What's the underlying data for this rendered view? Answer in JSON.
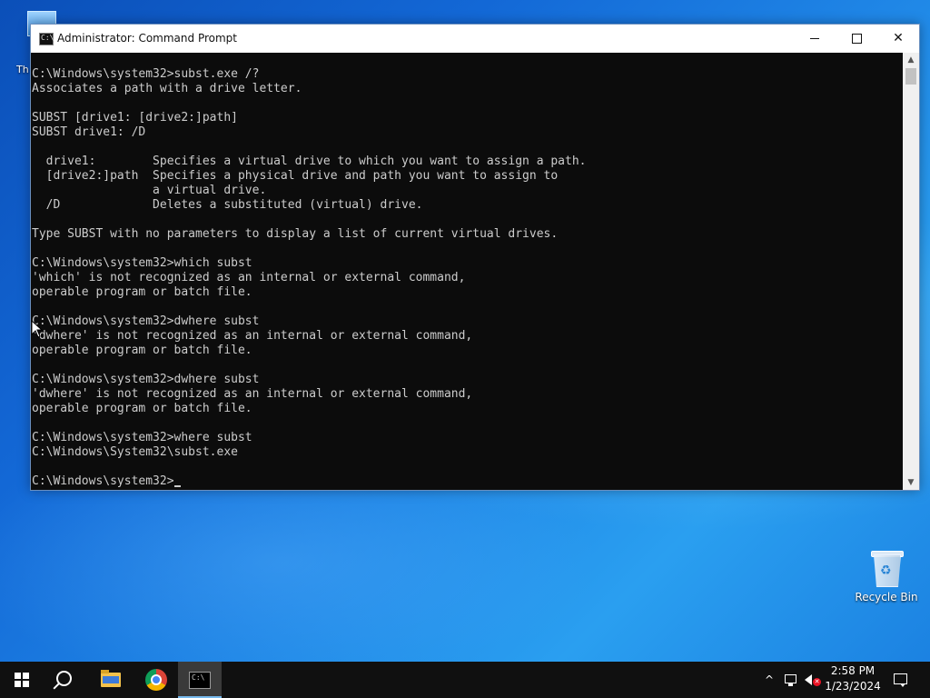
{
  "desktop": {
    "icons": [
      {
        "label": "Th"
      },
      {
        "label": "Recycle Bin"
      }
    ]
  },
  "window": {
    "title": "Administrator: Command Prompt",
    "icon_text": "C:\\",
    "console_lines": [
      "",
      "C:\\Windows\\system32>subst.exe /?",
      "Associates a path with a drive letter.",
      "",
      "SUBST [drive1: [drive2:]path]",
      "SUBST drive1: /D",
      "",
      "  drive1:        Specifies a virtual drive to which you want to assign a path.",
      "  [drive2:]path  Specifies a physical drive and path you want to assign to",
      "                 a virtual drive.",
      "  /D             Deletes a substituted (virtual) drive.",
      "",
      "Type SUBST with no parameters to display a list of current virtual drives.",
      "",
      "C:\\Windows\\system32>which subst",
      "'which' is not recognized as an internal or external command,",
      "operable program or batch file.",
      "",
      "C:\\Windows\\system32>dwhere subst",
      "'dwhere' is not recognized as an internal or external command,",
      "operable program or batch file.",
      "",
      "C:\\Windows\\system32>dwhere subst",
      "'dwhere' is not recognized as an internal or external command,",
      "operable program or batch file.",
      "",
      "C:\\Windows\\system32>where subst",
      "C:\\Windows\\System32\\subst.exe",
      ""
    ],
    "prompt": "C:\\Windows\\system32>"
  },
  "taskbar": {
    "apps": [
      {
        "name": "Start"
      },
      {
        "name": "Search"
      },
      {
        "name": "File Explorer"
      },
      {
        "name": "Google Chrome"
      },
      {
        "name": "Command Prompt",
        "active": true
      }
    ],
    "tray": {
      "chevron": "^"
    },
    "clock": {
      "time": "2:58 PM",
      "date": "1/23/2024"
    }
  },
  "colors": {
    "console_bg": "#0c0c0c",
    "console_fg": "#cccccc",
    "taskbar_bg": "#101010",
    "accent": "#76b9ed"
  }
}
